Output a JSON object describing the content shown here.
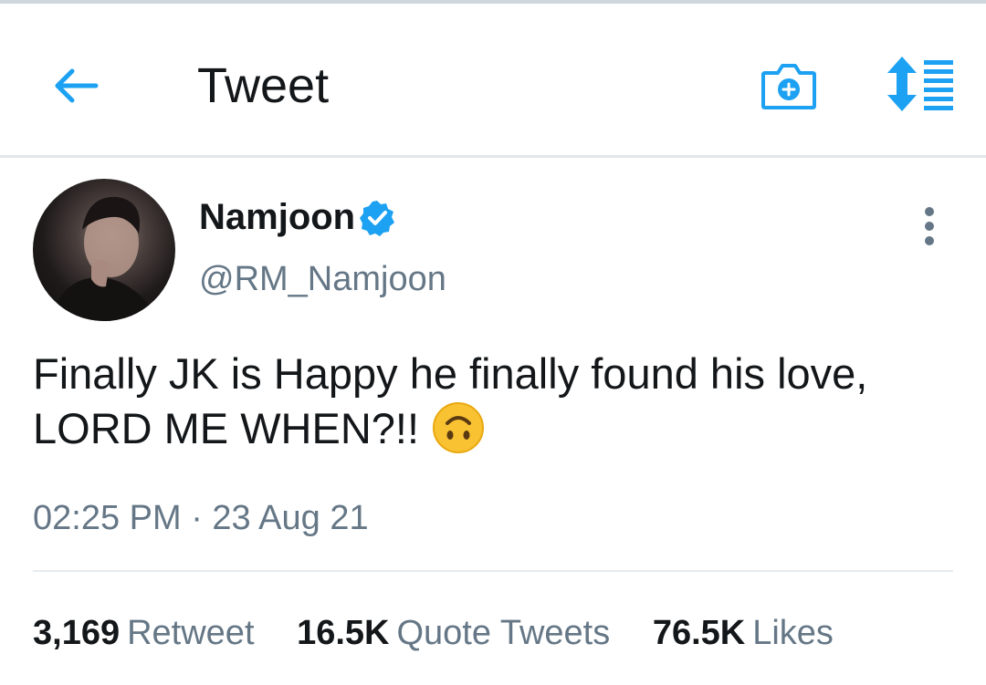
{
  "header": {
    "title": "Tweet",
    "back_icon": "arrow-left-icon",
    "camera_icon": "camera-plus-icon",
    "sort_icon": "sort-list-icon",
    "accent_color": "#1da1f2"
  },
  "tweet": {
    "author": {
      "display_name": "Namjoon",
      "handle": "@RM_Namjoon",
      "verified": true,
      "verified_icon": "verified-badge-icon"
    },
    "text": "Finally JK is Happy he finally found his love, LORD ME WHEN?!!",
    "emoji": "upside-down-face-emoji",
    "more_icon": "more-vertical-icon",
    "timestamp": "02:25 PM · 23 Aug 21",
    "stats": {
      "retweets_count": "3,169",
      "retweets_label": "Retweet",
      "quotes_count": "16.5K",
      "quotes_label": "Quote Tweets",
      "likes_count": "76.5K",
      "likes_label": "Likes"
    }
  }
}
